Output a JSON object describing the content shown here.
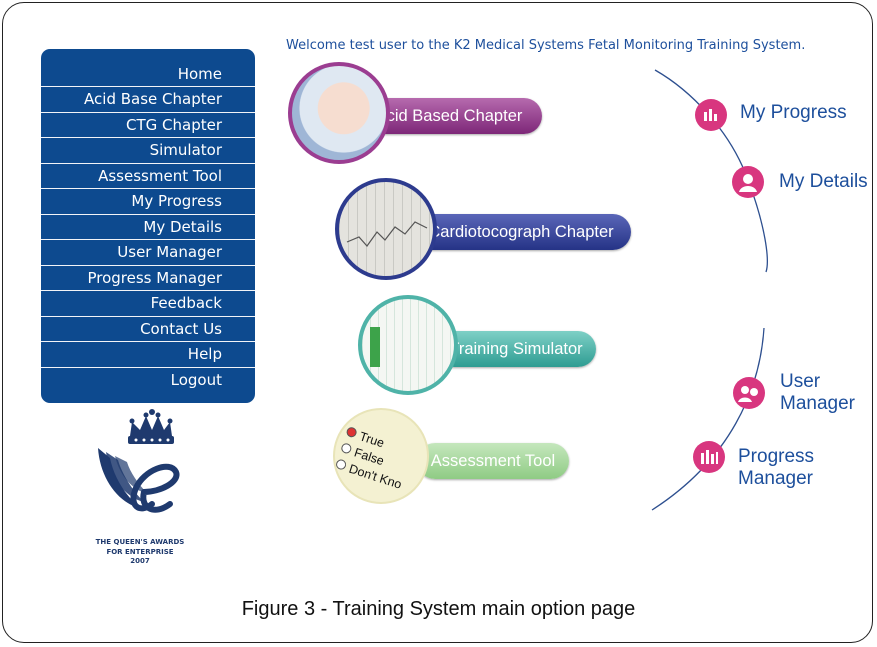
{
  "welcome": "Welcome test user to the K2 Medical Systems Fetal Monitoring Training System.",
  "nav": [
    "Home",
    "Acid Base Chapter",
    "CTG Chapter",
    "Simulator",
    "Assessment Tool",
    "My Progress",
    "My Details",
    "User Manager",
    "Progress Manager",
    "Feedback",
    "Contact Us",
    "Help",
    "Logout"
  ],
  "options": {
    "acid": "Acid Based Chapter",
    "ctg": "Cardiotocograph Chapter",
    "sim": "Training Simulator",
    "assess": "Assessment Tool"
  },
  "assess_words": {
    "true": "True",
    "false": "False",
    "dont": "Don't Kno"
  },
  "right_links": {
    "progress": "My Progress",
    "details": "My Details",
    "user_1": "User",
    "user_2": "Manager",
    "pm_1": "Progress",
    "pm_2": "Manager"
  },
  "award": {
    "line1": "THE QUEEN'S AWARDS",
    "line2": "FOR ENTERPRISE",
    "line3": "2007"
  },
  "caption": "Figure 3 - Training System main option page",
  "colors": {
    "nav_bg": "#0d4a8f",
    "link": "#1d4f9c",
    "icon": "#d8367f",
    "pill_purple": "#8a2f86",
    "pill_blue": "#2d3b8e",
    "pill_teal": "#3aaaa0",
    "pill_green": "#8fcb84"
  }
}
